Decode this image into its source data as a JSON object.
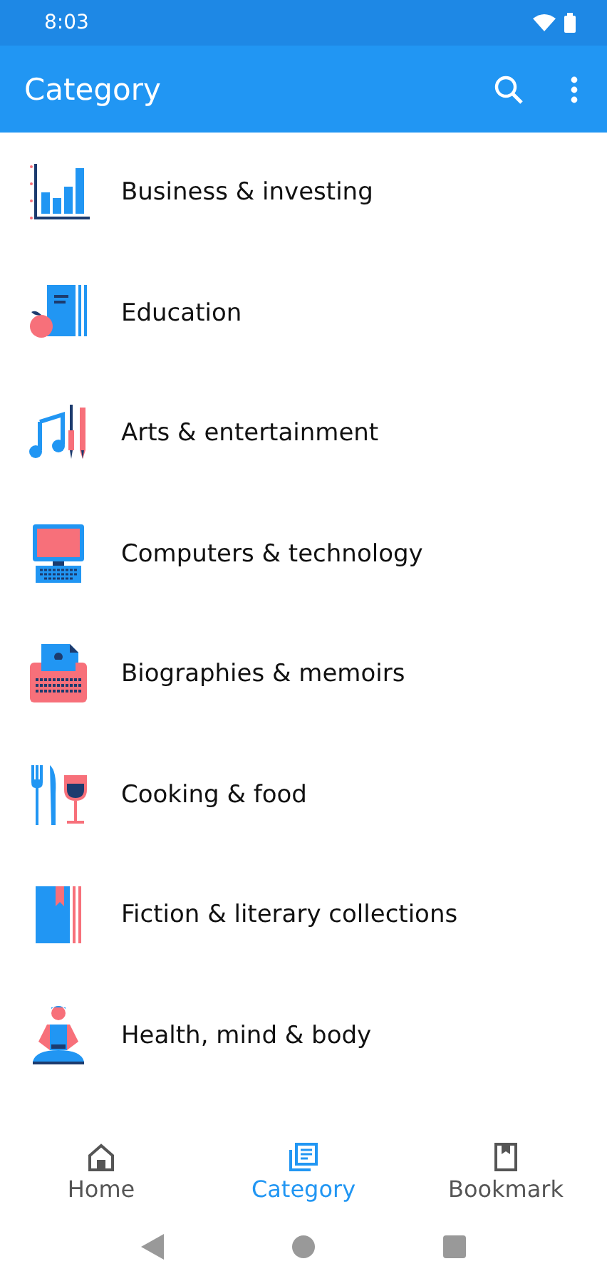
{
  "status_bar": {
    "time": "8:03"
  },
  "app_bar": {
    "title": "Category"
  },
  "categories": [
    {
      "label": "Business & investing",
      "kind": "chart"
    },
    {
      "label": "Education",
      "kind": "books"
    },
    {
      "label": "Arts & entertainment",
      "kind": "music"
    },
    {
      "label": "Computers & technology",
      "kind": "computer"
    },
    {
      "label": "Biographies & memoirs",
      "kind": "typewriter"
    },
    {
      "label": "Cooking & food",
      "kind": "food"
    },
    {
      "label": "Fiction & literary collections",
      "kind": "book"
    },
    {
      "label": "Health, mind & body",
      "kind": "yoga"
    }
  ],
  "bottom_nav": [
    {
      "label": "Home",
      "kind": "home",
      "selected": false
    },
    {
      "label": "Category",
      "kind": "category",
      "selected": true
    },
    {
      "label": "Bookmark",
      "kind": "bookmark",
      "selected": false
    }
  ]
}
